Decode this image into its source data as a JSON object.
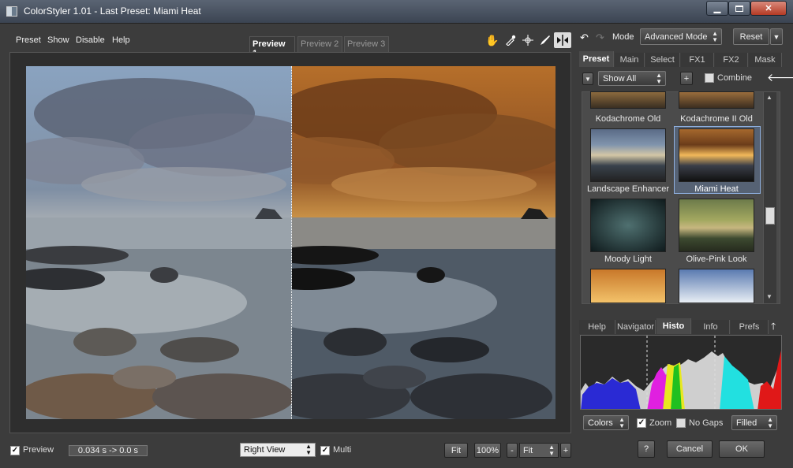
{
  "window": {
    "title": "ColorStyler 1.01 - Last Preset: Miami Heat"
  },
  "menu": [
    "Preset",
    "Show",
    "Disable",
    "Help"
  ],
  "preview_tabs": [
    "Preview 1",
    "Preview 2",
    "Preview 3"
  ],
  "toolbar": {
    "mode_label": "Mode",
    "mode_value": "Advanced Mode",
    "reset": "Reset"
  },
  "right_tabs": [
    "Preset",
    "Main",
    "Select",
    "FX1",
    "FX2",
    "Mask"
  ],
  "preset_filter": {
    "show_value": "Show All",
    "plus": "+",
    "combine_label": "Combine"
  },
  "presets": [
    {
      "name": "Kodachrome Old"
    },
    {
      "name": "Kodachrome II Old"
    },
    {
      "name": "Landscape Enhancer"
    },
    {
      "name": "Miami Heat",
      "selected": true
    },
    {
      "name": "Moody Light"
    },
    {
      "name": "Olive-Pink Look"
    }
  ],
  "bottom_tabs": [
    "Help",
    "Navigator",
    "Histo",
    "Info",
    "Prefs"
  ],
  "histo_controls": {
    "colors": "Colors",
    "zoom_label": "Zoom",
    "nogaps_label": "No Gaps",
    "fill": "Filled"
  },
  "statusbar": {
    "preview_label": "Preview",
    "timing": "0.034 s -> 0.0 s",
    "view_value": "Right View",
    "multi_label": "Multi",
    "fit1": "Fit",
    "zoom": "100%",
    "minus": "-",
    "fit2": "Fit",
    "plus": "+"
  },
  "dialog": {
    "help": "?",
    "cancel": "Cancel",
    "ok": "OK"
  },
  "colors": {
    "accent": "#6d8fc2",
    "background": "#3c3c3c"
  }
}
